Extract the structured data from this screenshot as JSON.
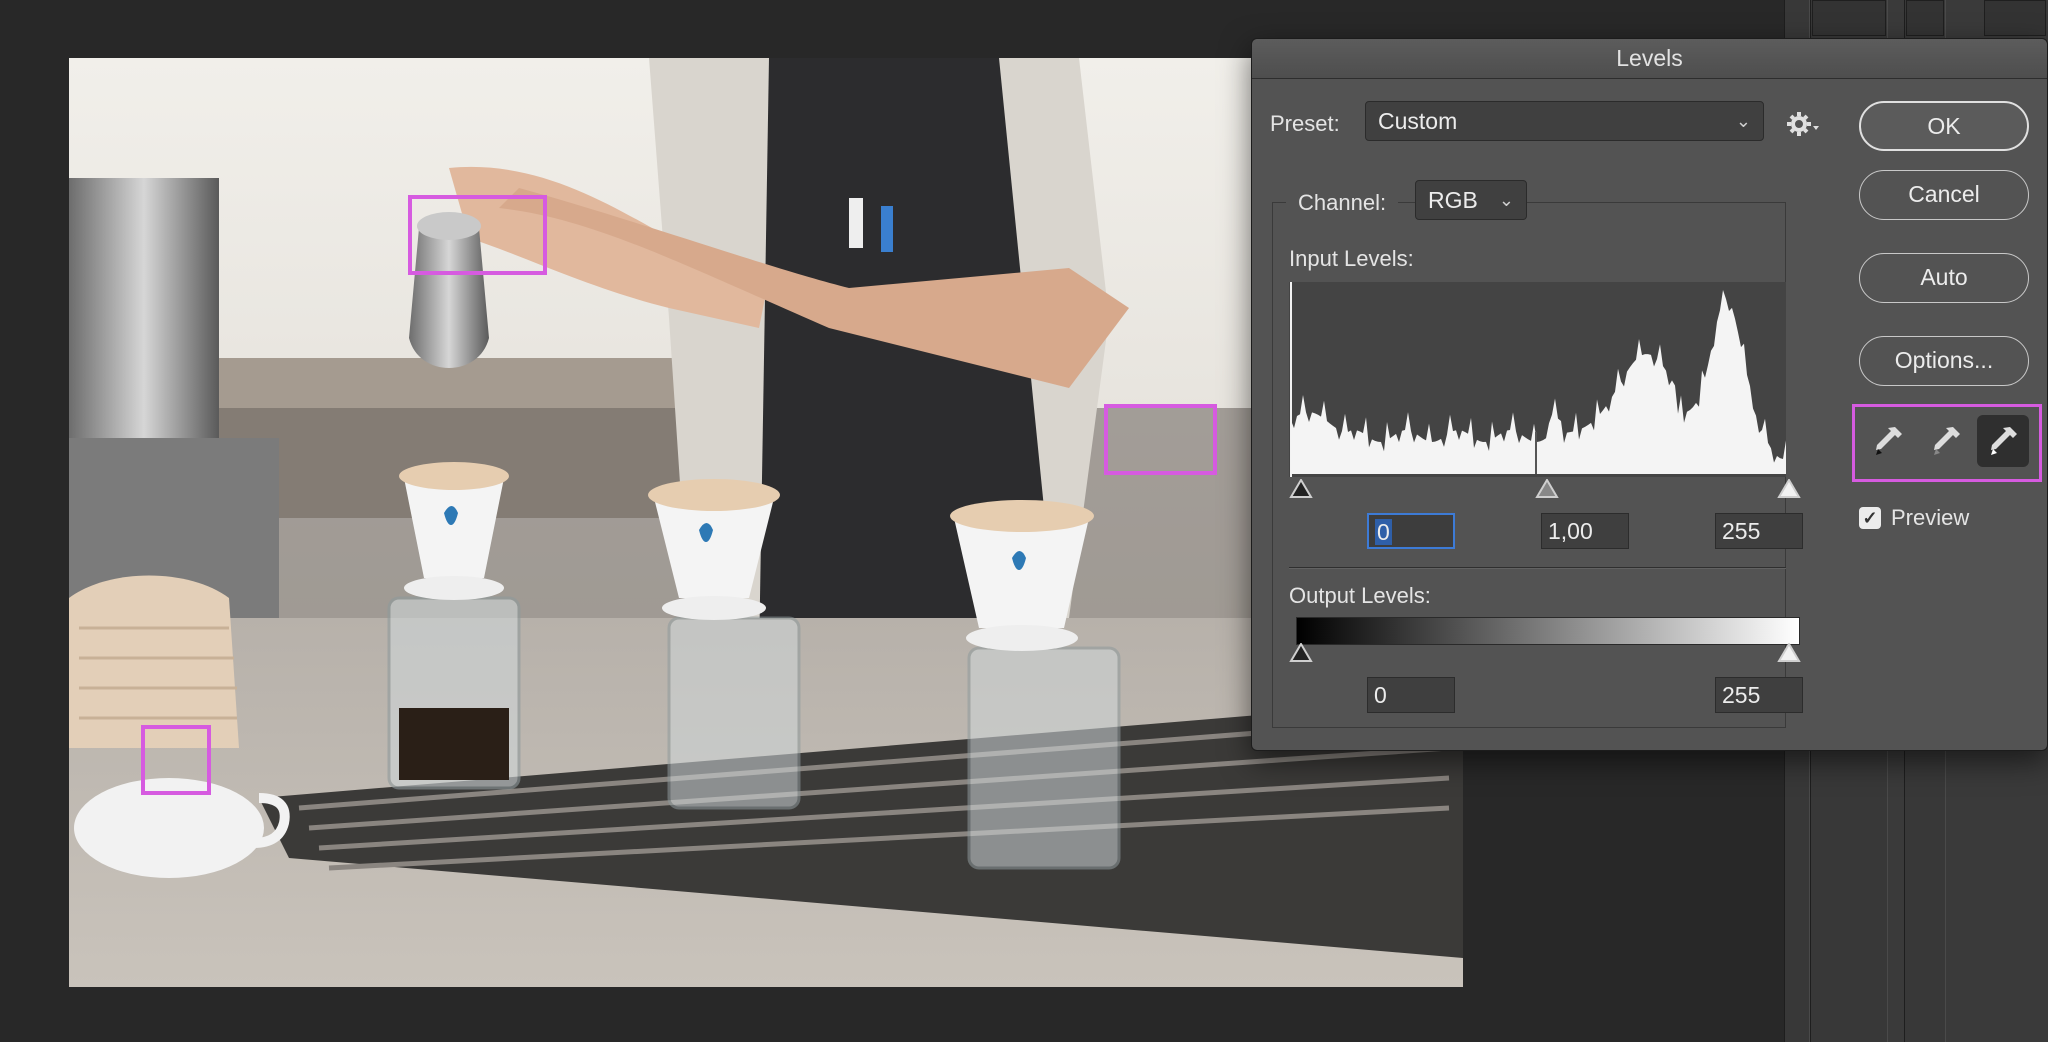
{
  "dialog": {
    "title": "Levels",
    "preset_label": "Preset:",
    "preset_value": "Custom",
    "channel_label": "Channel:",
    "channel_value": "RGB",
    "input_levels_label": "Input Levels:",
    "input_black": "0",
    "input_gamma": "1,00",
    "input_white": "255",
    "output_levels_label": "Output Levels:",
    "output_black": "0",
    "output_white": "255",
    "buttons": {
      "ok": "OK",
      "cancel": "Cancel",
      "auto": "Auto",
      "options": "Options..."
    },
    "preview_label": "Preview",
    "preview_checked": true
  },
  "icons": {
    "gear": "gear-icon",
    "black_eyedropper": "black-point-eyedropper-icon",
    "gray_eyedropper": "gray-point-eyedropper-icon",
    "white_eyedropper": "white-point-eyedropper-icon"
  },
  "colors": {
    "dialog_bg": "#535353",
    "highlight_box": "#d65be0",
    "focus_field": "#3d7bd6",
    "canvas_bg": "#282828"
  }
}
